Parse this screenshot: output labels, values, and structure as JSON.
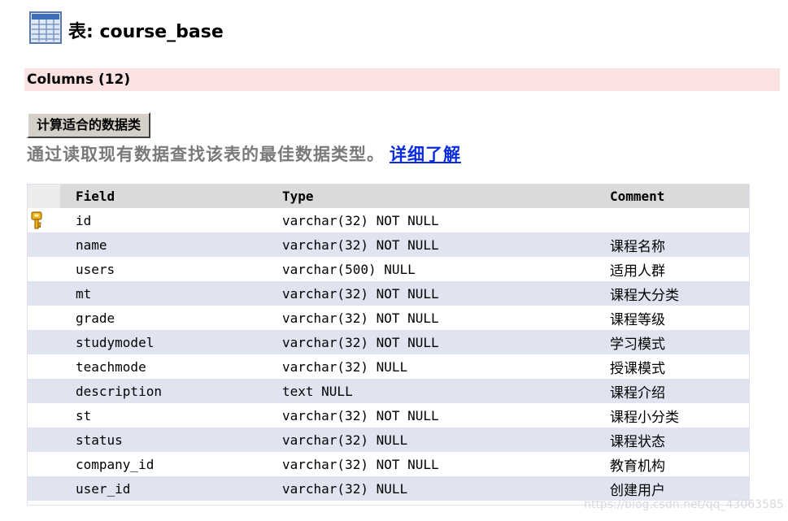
{
  "header": {
    "title": "表: course_base"
  },
  "columns_section": {
    "label": "Columns (12)"
  },
  "calc_button": {
    "label": "计算适合的数据类"
  },
  "description": {
    "text": "通过读取现有数据查找该表的最佳数据类型。",
    "link": "详细了解"
  },
  "table": {
    "headers": {
      "field": "Field",
      "type": "Type",
      "comment": "Comment"
    },
    "rows": [
      {
        "key": true,
        "field": "id",
        "type": "varchar(32) NOT NULL",
        "comment": ""
      },
      {
        "key": false,
        "field": "name",
        "type": "varchar(32) NOT NULL",
        "comment": "课程名称"
      },
      {
        "key": false,
        "field": "users",
        "type": "varchar(500) NULL",
        "comment": "适用人群"
      },
      {
        "key": false,
        "field": "mt",
        "type": "varchar(32) NOT NULL",
        "comment": "课程大分类"
      },
      {
        "key": false,
        "field": "grade",
        "type": "varchar(32) NOT NULL",
        "comment": "课程等级"
      },
      {
        "key": false,
        "field": "studymodel",
        "type": "varchar(32) NOT NULL",
        "comment": "学习模式"
      },
      {
        "key": false,
        "field": "teachmode",
        "type": "varchar(32) NULL",
        "comment": "授课模式"
      },
      {
        "key": false,
        "field": "description",
        "type": "text NULL",
        "comment": "课程介绍"
      },
      {
        "key": false,
        "field": "st",
        "type": "varchar(32) NOT NULL",
        "comment": "课程小分类"
      },
      {
        "key": false,
        "field": "status",
        "type": "varchar(32) NULL",
        "comment": "课程状态"
      },
      {
        "key": false,
        "field": "company_id",
        "type": "varchar(32) NOT NULL",
        "comment": "教育机构"
      },
      {
        "key": false,
        "field": "user_id",
        "type": "varchar(32) NULL",
        "comment": "创建用户"
      }
    ]
  },
  "watermark": {
    "text": "https://blog.csdn.net/qq_43063585"
  },
  "icons": {
    "table": "table-grid-icon",
    "primary_key": "key-icon"
  },
  "colors": {
    "columns_bar": "#fbe2e3",
    "row_alt": "#dfe4f0",
    "header": "#dadada",
    "link": "#0a2ce0"
  }
}
